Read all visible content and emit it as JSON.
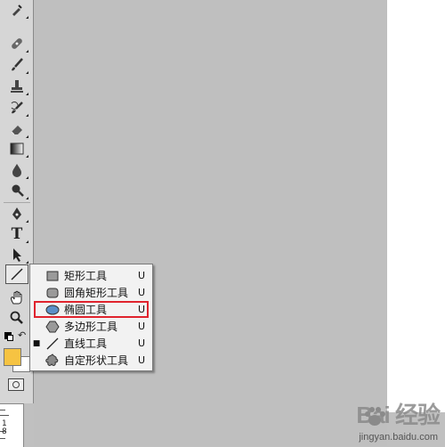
{
  "toolbar": {
    "tools": [
      {
        "name": "eyedropper-tool"
      },
      {
        "name": "healing-brush-tool"
      },
      {
        "name": "brush-tool"
      },
      {
        "name": "clone-stamp-tool"
      },
      {
        "name": "history-brush-tool"
      },
      {
        "name": "eraser-tool"
      },
      {
        "name": "gradient-tool"
      },
      {
        "name": "blur-tool"
      },
      {
        "name": "dodge-tool"
      },
      {
        "name": "pen-tool"
      },
      {
        "name": "type-tool",
        "glyph": "T"
      },
      {
        "name": "path-selection-tool"
      },
      {
        "name": "line-tool",
        "active": true
      },
      {
        "name": "hand-tool"
      },
      {
        "name": "zoom-tool"
      }
    ],
    "foreground_color": "#f6c342",
    "background_color": "#ffffff"
  },
  "flyout_menu": {
    "items": [
      {
        "label": "矩形工具",
        "shortcut": "U",
        "icon": "rectangle-icon",
        "current": false
      },
      {
        "label": "圆角矩形工具",
        "shortcut": "U",
        "icon": "rounded-rectangle-icon",
        "current": false
      },
      {
        "label": "椭圆工具",
        "shortcut": "U",
        "icon": "ellipse-icon",
        "current": false,
        "highlighted": true
      },
      {
        "label": "多边形工具",
        "shortcut": "U",
        "icon": "polygon-icon",
        "current": false
      },
      {
        "label": "直线工具",
        "shortcut": "U",
        "icon": "line-icon",
        "current": true
      },
      {
        "label": "自定形状工具",
        "shortcut": "U",
        "icon": "custom-shape-icon",
        "current": false
      }
    ],
    "bullet": "■"
  },
  "ruler": {
    "number": "1\n8"
  },
  "watermark": {
    "brand": "Bai 经验",
    "url": "jingyan.baidu.com"
  },
  "colors": {
    "highlight": "#e0232d",
    "workspace": "#bfbfbf"
  }
}
